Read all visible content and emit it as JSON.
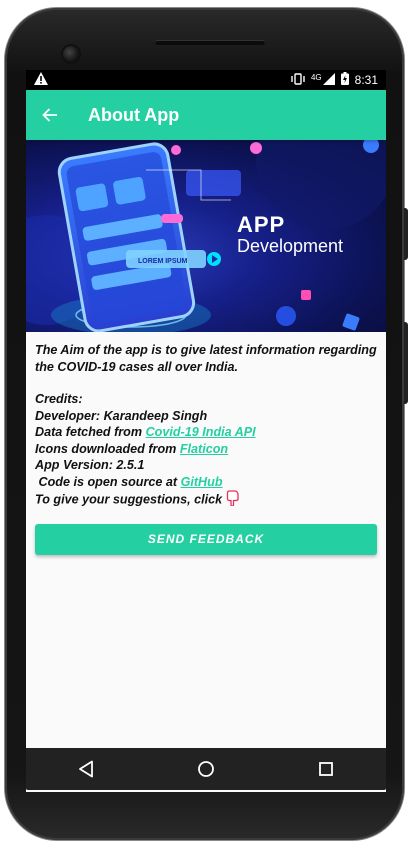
{
  "status": {
    "time": "8:31",
    "network": "4G"
  },
  "appbar": {
    "title": "About App"
  },
  "banner": {
    "headline": "APP",
    "subline": "Development",
    "mock_label": "LOREM IPSUM"
  },
  "about": {
    "aim": "The Aim of the app is to give latest information regarding the COVID-19 cases all over India.",
    "credits_heading": "Credits:",
    "developer": "Developer: Karandeep Singh",
    "data_prefix": "Data fetched from ",
    "data_link": "Covid-19 India API",
    "icons_prefix": "Icons downloaded from ",
    "icons_link": "Flaticon",
    "version": "App Version: 2.5.1",
    "source_prefix": " Code is open source at ",
    "source_link": "GitHub",
    "suggestions": "To give your suggestions, click "
  },
  "buttons": {
    "feedback": "SEND FEEDBACK"
  },
  "colors": {
    "accent": "#24d0a1",
    "banner_bg": "#16208a"
  }
}
